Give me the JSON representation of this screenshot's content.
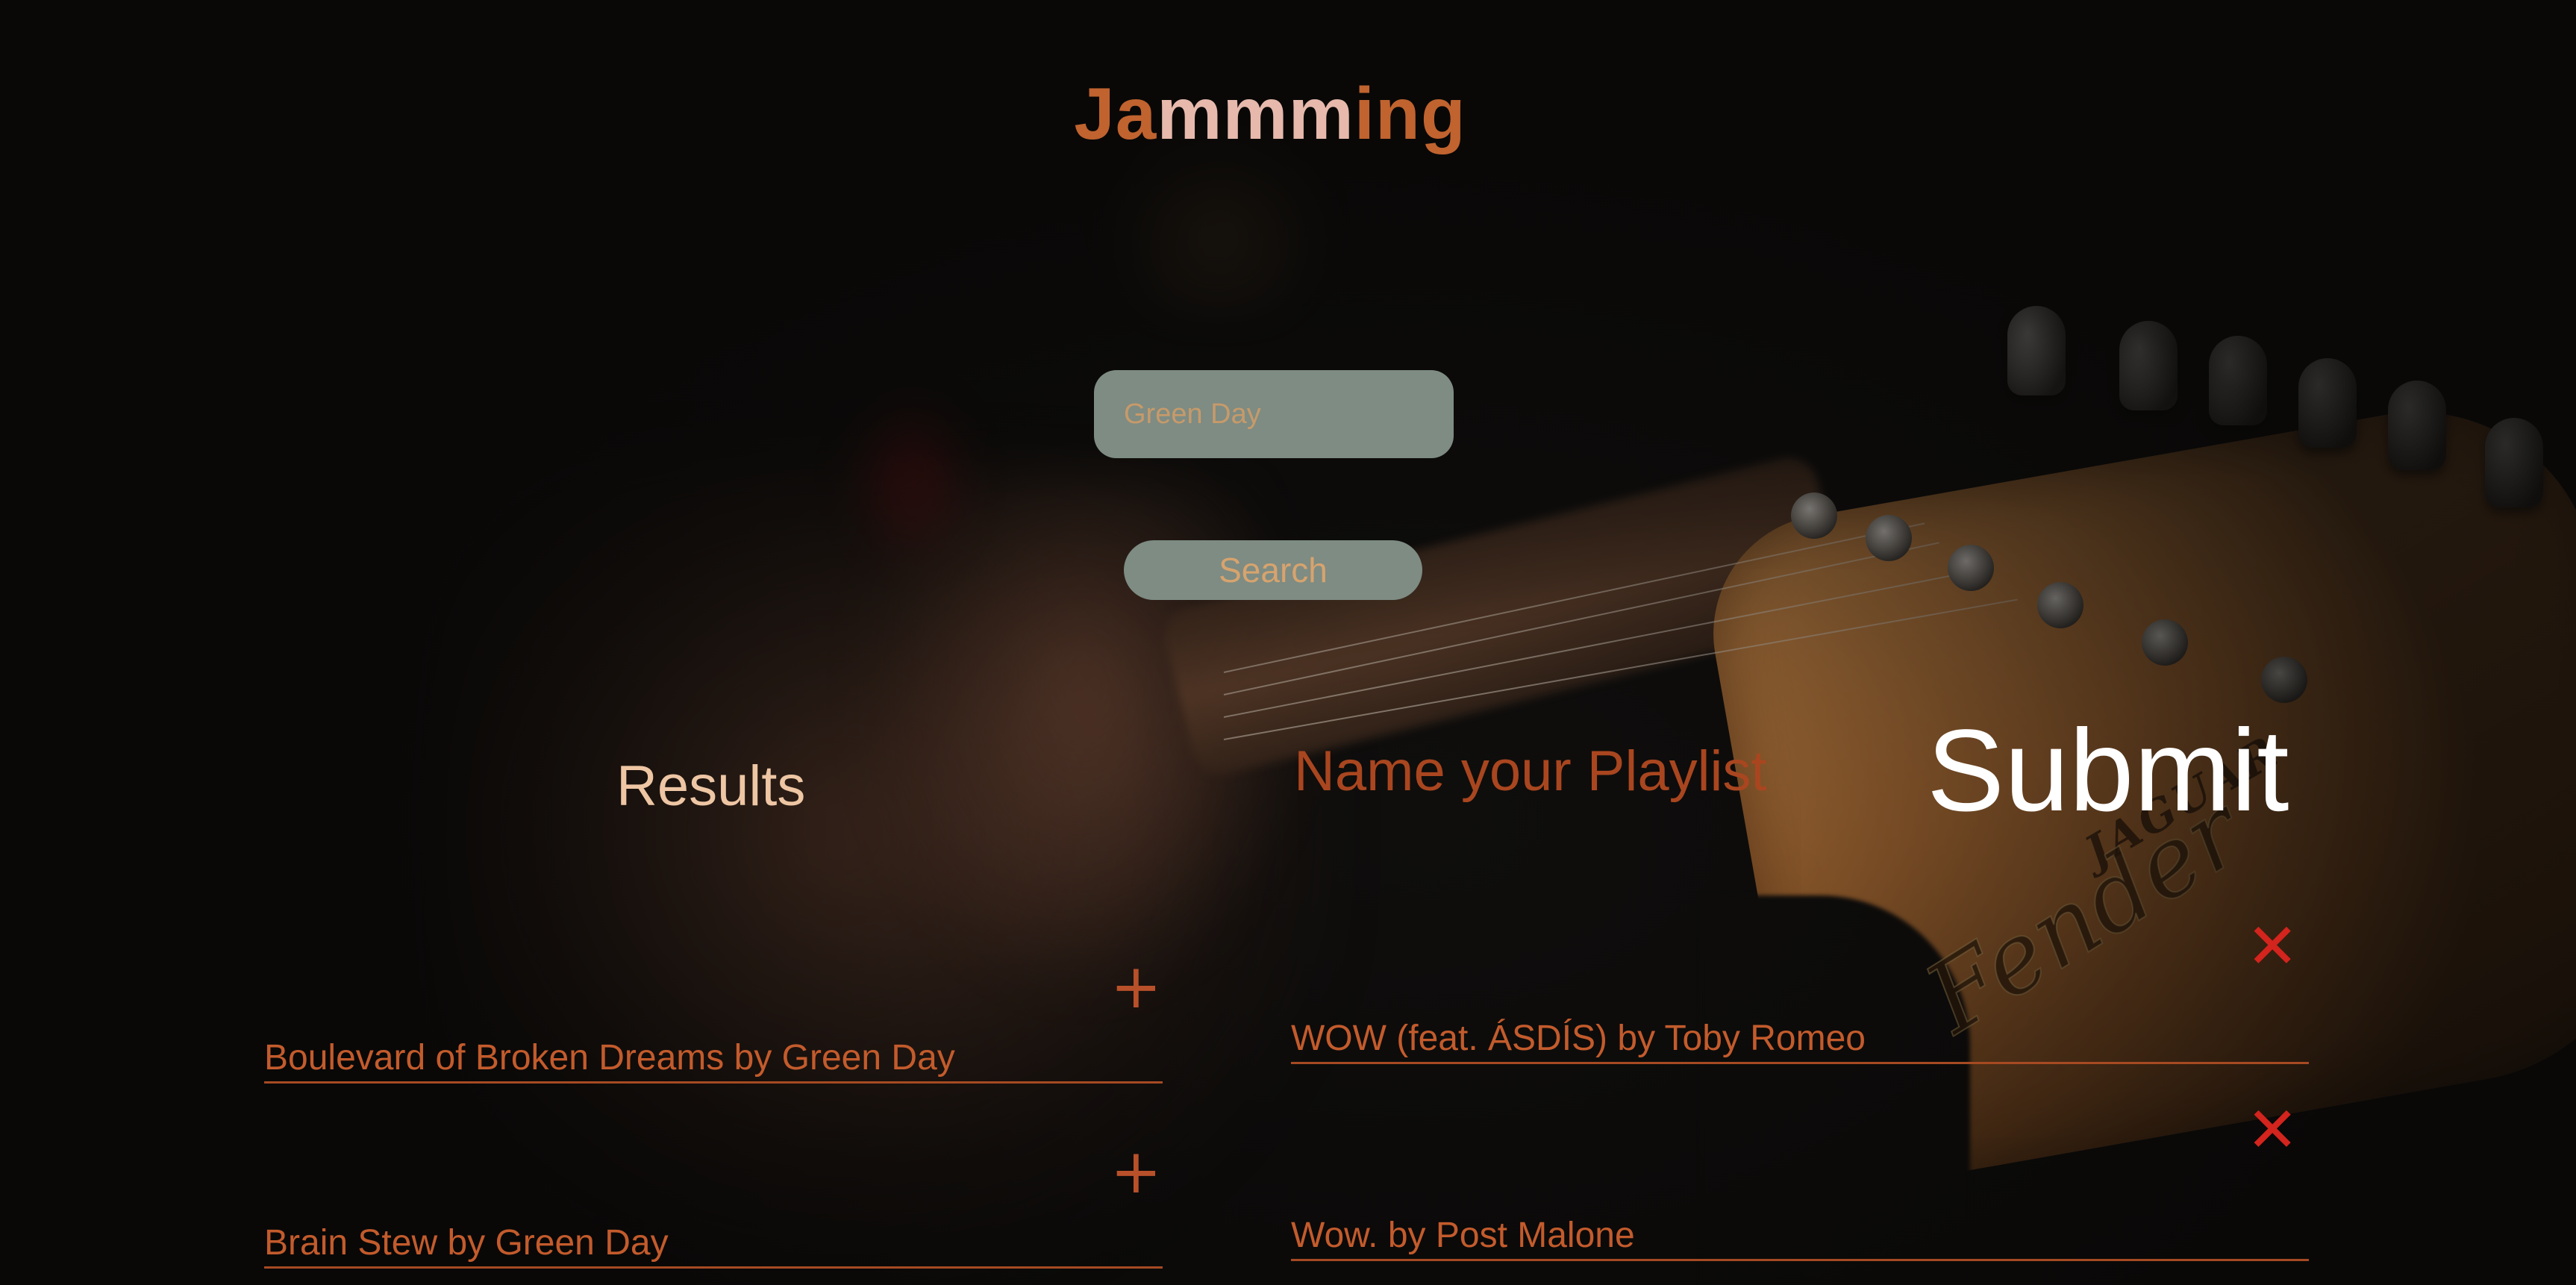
{
  "app": {
    "title_parts": [
      "Ja",
      "mmm",
      "ing"
    ]
  },
  "search": {
    "input_value": "Green Day",
    "button_label": "Search"
  },
  "results": {
    "heading": "Results",
    "add_icon": "+",
    "items": [
      {
        "label": "Boulevard of Broken Dreams by Green Day"
      },
      {
        "label": "Brain Stew by Green Day"
      }
    ]
  },
  "playlist": {
    "name_placeholder": "Name your Playlist",
    "submit_label": "Submit",
    "remove_icon": "✕",
    "items": [
      {
        "label": "WOW (feat. ÁSDÍS) by Toby Romeo"
      },
      {
        "label": "Wow. by Post Malone"
      }
    ]
  },
  "colors": {
    "title_accent": "#c0632f",
    "title_light": "#e6b9ac",
    "track_text": "#c35b2c",
    "remove_red": "#d3241d",
    "control_bg": "#7e8c83"
  },
  "icons": {
    "add": "plus-icon",
    "remove": "close-icon"
  }
}
